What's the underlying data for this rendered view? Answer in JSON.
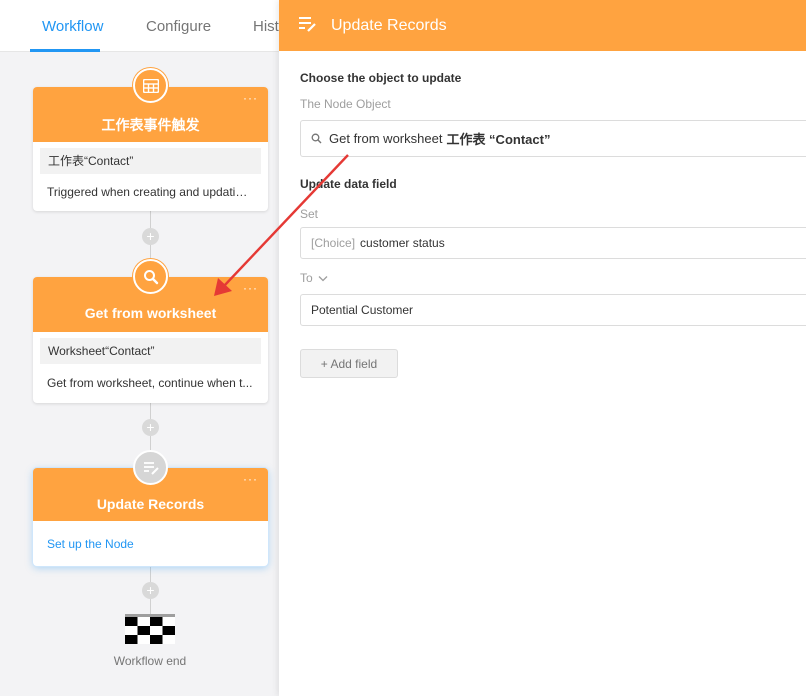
{
  "tabs": {
    "workflow": "Workflow",
    "configure": "Configure",
    "history": "Hist"
  },
  "nodes": {
    "trigger": {
      "title": "工作表事件触发",
      "chip": "工作表“Contact”",
      "desc": "Triggered when creating and updating..."
    },
    "get": {
      "title": "Get from worksheet",
      "chip": "Worksheet“Contact”",
      "desc": "Get from worksheet, continue when t..."
    },
    "update": {
      "title": "Update Records",
      "link": "Set up the Node"
    },
    "end": {
      "label": "Workflow end"
    }
  },
  "node_more": "···",
  "plus": "+",
  "panel": {
    "title": "Update Records",
    "choose_title": "Choose the object to update",
    "node_object_label": "The Node Object",
    "node_object_value": "Get from worksheet",
    "node_object_sheet": "工作表 “Contact”",
    "update_title": "Update data field",
    "set_label": "Set",
    "set_type": "[Choice]",
    "set_value": "customer status",
    "to_label": "To",
    "to_value": "Potential Customer",
    "add_field": "+ Add field"
  },
  "colors": {
    "accent": "#ffa340",
    "link": "#2196f3",
    "arrow": "#e53935"
  },
  "icons": {
    "trigger": "table-icon",
    "get": "search-icon",
    "update": "edit-list-icon",
    "end": "checkered-flag-icon"
  }
}
